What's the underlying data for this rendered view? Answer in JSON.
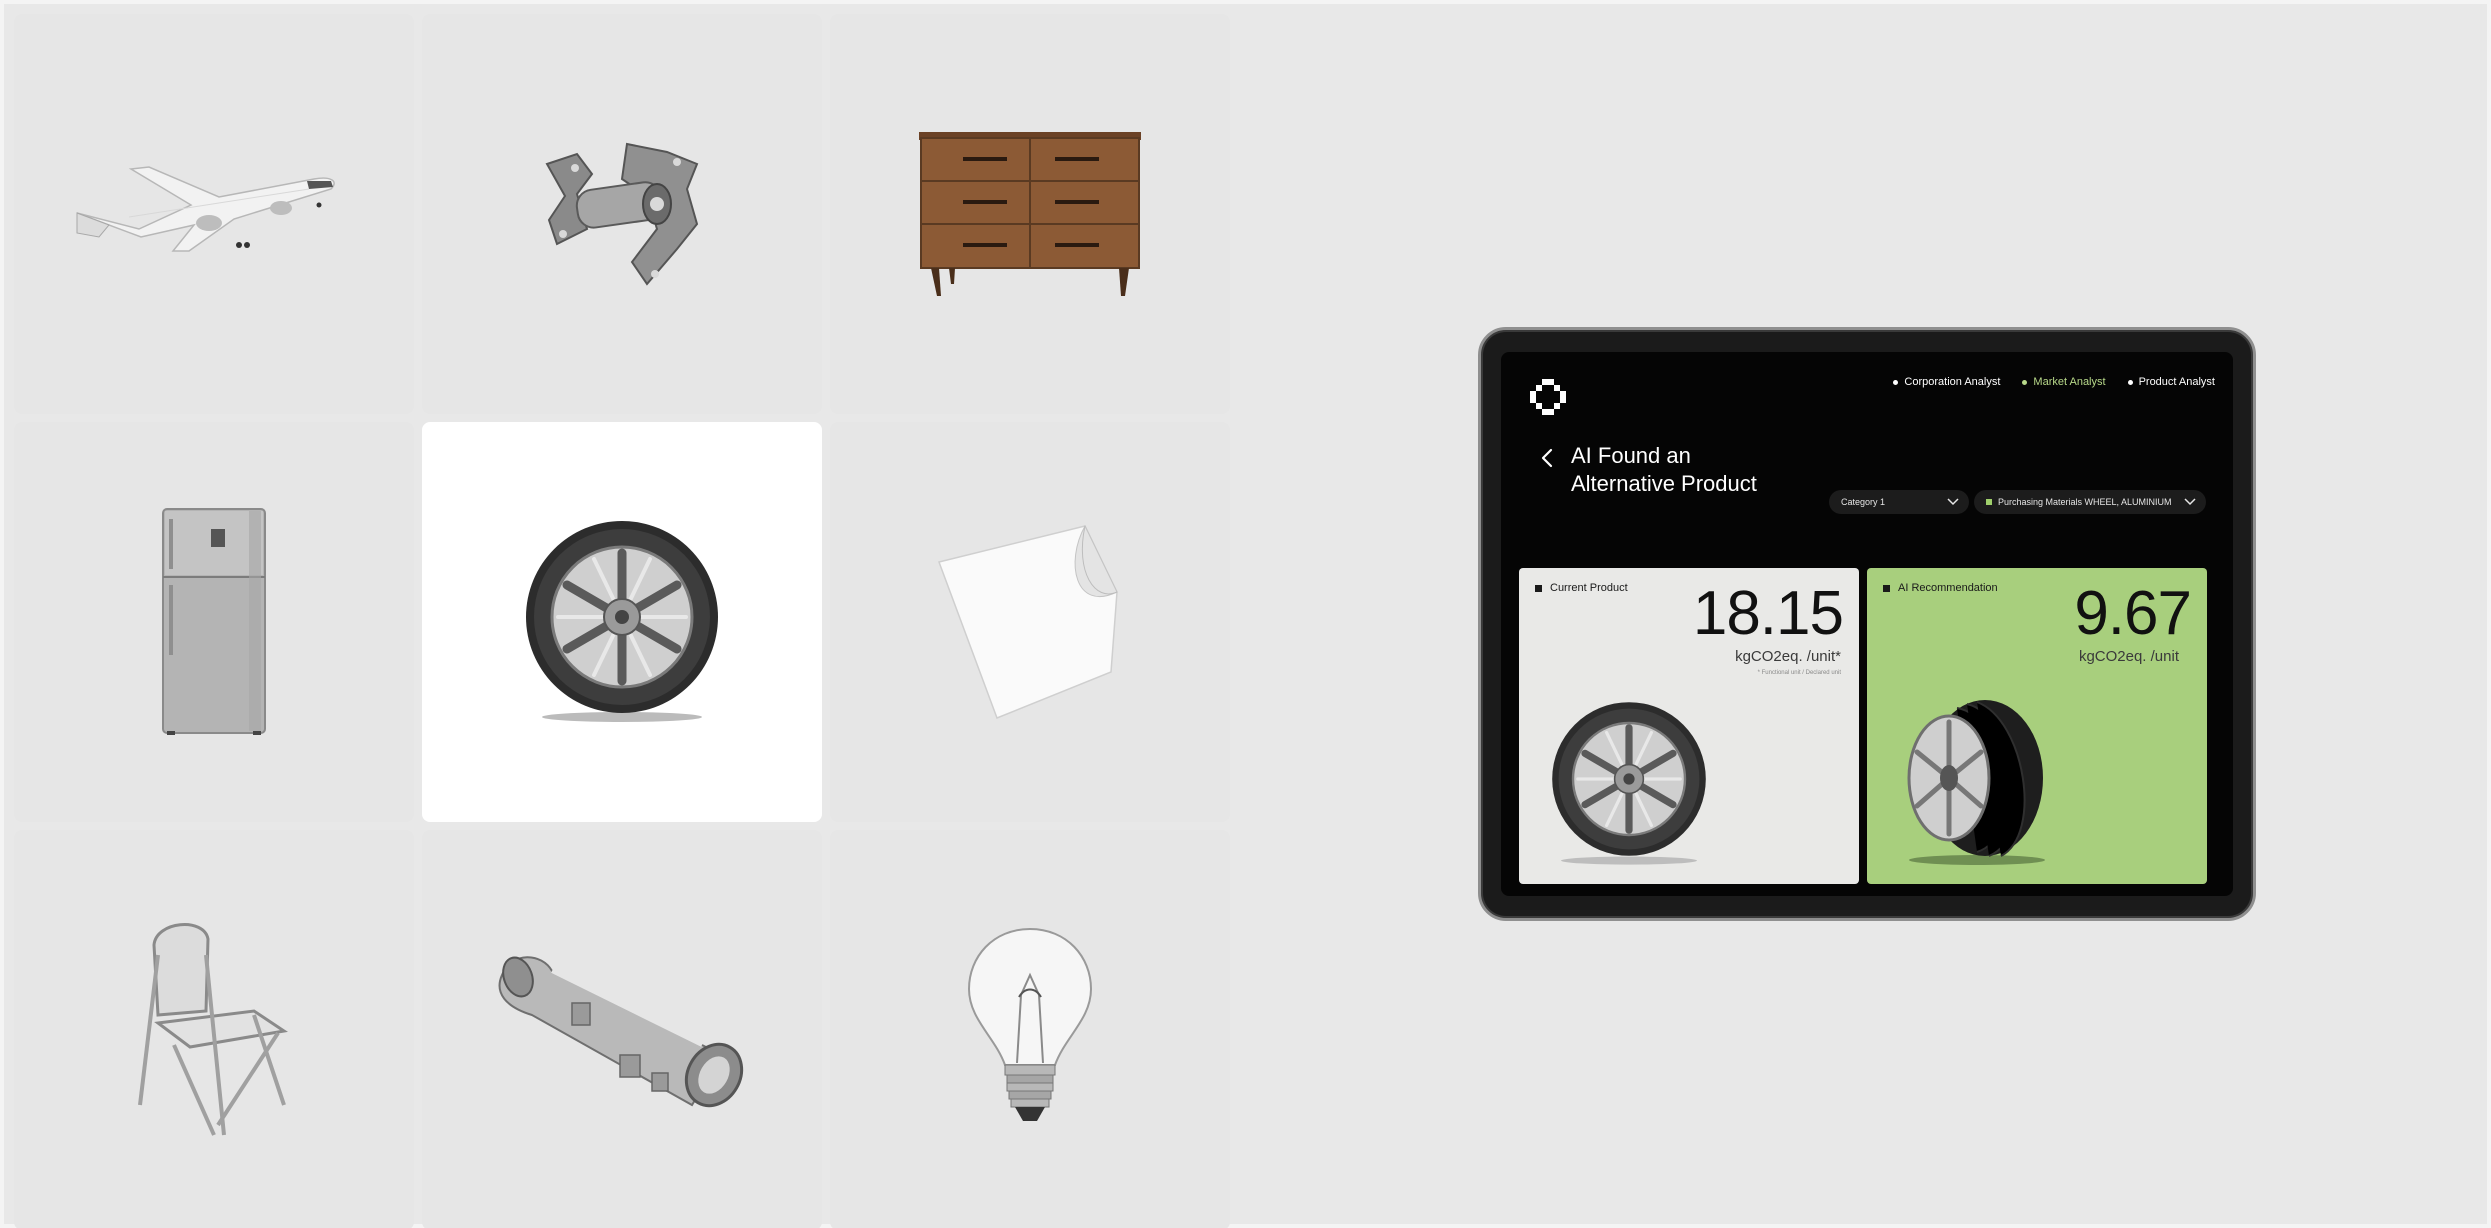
{
  "grid": {
    "tiles": [
      {
        "icon": "airplane-icon",
        "selected": false
      },
      {
        "icon": "machine-part-icon",
        "selected": false
      },
      {
        "icon": "dresser-icon",
        "selected": false
      },
      {
        "icon": "refrigerator-icon",
        "selected": false
      },
      {
        "icon": "wheel-icon",
        "selected": true
      },
      {
        "icon": "paper-sheet-icon",
        "selected": false
      },
      {
        "icon": "folding-chair-icon",
        "selected": false
      },
      {
        "icon": "metal-pipe-part-icon",
        "selected": false
      },
      {
        "icon": "light-bulb-icon",
        "selected": false
      }
    ]
  },
  "tablet": {
    "nav": [
      {
        "label": "Corporation Analyst",
        "active": false
      },
      {
        "label": "Market Analyst",
        "active": true
      },
      {
        "label": "Product Analyst",
        "active": false
      }
    ],
    "title_line1": "AI Found an",
    "title_line2": "Alternative Product",
    "category_select": "Category 1",
    "material_select": "Purchasing Materials WHEEL, ALUMINIUM",
    "current": {
      "tag": "Current Product",
      "value": "18.15",
      "unit": "kgCO2eq. /unit*",
      "footnote": "* Functional unit / Declared unit"
    },
    "recommendation": {
      "tag": "AI Recommendation",
      "value": "9.67",
      "unit": "kgCO2eq. /unit"
    }
  },
  "colors": {
    "accent_green": "#a8cf7d",
    "active_nav": "#b8d98a",
    "background": "#e8e8e8"
  }
}
